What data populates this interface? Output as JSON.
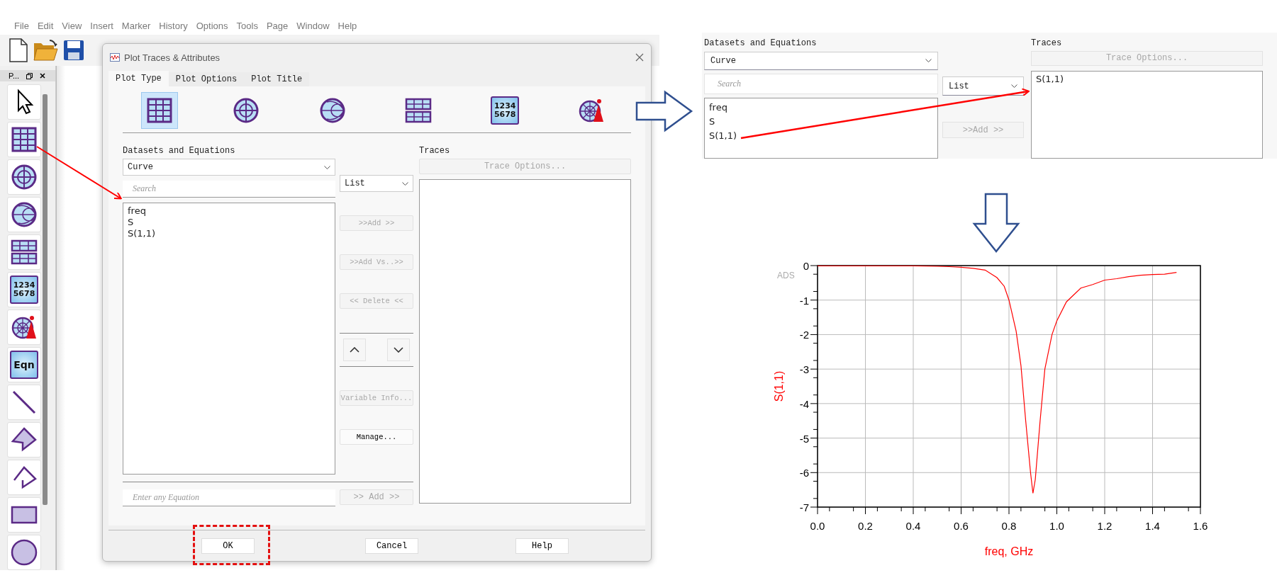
{
  "app": {
    "menu": [
      "File",
      "Edit",
      "View",
      "Insert",
      "Marker",
      "History",
      "Options",
      "Tools",
      "Page",
      "Window",
      "Help"
    ],
    "palette": {
      "title": "P...",
      "tools": [
        {
          "kind": "pointer"
        },
        {
          "kind": "grid"
        },
        {
          "kind": "polar"
        },
        {
          "kind": "smith"
        },
        {
          "kind": "list"
        },
        {
          "kind": "numbers",
          "lines": [
            "1234",
            "5678"
          ]
        },
        {
          "kind": "antenna"
        },
        {
          "kind": "equation",
          "label": "Eqn"
        },
        {
          "kind": "line"
        },
        {
          "kind": "polygon"
        },
        {
          "kind": "polyline"
        },
        {
          "kind": "rectangle"
        },
        {
          "kind": "circle"
        }
      ]
    }
  },
  "dialog": {
    "title": "Plot Traces & Attributes",
    "tabs": [
      {
        "label": "Plot Type",
        "selected": true
      },
      {
        "label": "Plot Options",
        "selected": false
      },
      {
        "label": "Plot Title",
        "selected": false
      }
    ],
    "plot_types": [
      {
        "kind": "grid",
        "selected": true
      },
      {
        "kind": "polar",
        "selected": false
      },
      {
        "kind": "smith",
        "selected": false
      },
      {
        "kind": "list",
        "selected": false
      },
      {
        "kind": "numbers",
        "lines": [
          "1234",
          "5678"
        ],
        "selected": false
      },
      {
        "kind": "antenna",
        "selected": false
      }
    ],
    "datasets_label": "Datasets and Equations",
    "source_dropdown": "Curve",
    "search": {
      "placeholder": "Search"
    },
    "variables": [
      "freq",
      "S",
      "S(1,1)"
    ],
    "view_dropdown": "List",
    "actions": [
      {
        "kind": "button",
        "label": ">>Add >>",
        "disabled": true
      },
      {
        "kind": "button",
        "label": ">>Add Vs..>>",
        "disabled": true
      },
      {
        "kind": "button",
        "label": "<< Delete <<",
        "disabled": true
      },
      {
        "kind": "reorder"
      },
      {
        "kind": "button",
        "label": "Variable Info...",
        "disabled": true
      },
      {
        "kind": "button",
        "label": "Manage...",
        "disabled": false
      }
    ],
    "equation": {
      "placeholder": "Enter any Equation"
    },
    "equation_button": {
      "label": ">> Add >>",
      "disabled": true
    },
    "traces_label": "Traces",
    "trace_options": {
      "label": "Trace Options...",
      "disabled": true
    },
    "footer_buttons": [
      {
        "label": "OK"
      },
      {
        "label": "Cancel"
      },
      {
        "label": "Help"
      }
    ]
  },
  "zoom_panel": {
    "datasets_label": "Datasets and Equations",
    "source_dropdown": "Curve",
    "search": {
      "placeholder": "Search"
    },
    "view_dropdown": "List",
    "variables": [
      "freq",
      "S",
      "S(1,1)"
    ],
    "add_button": {
      "label": ">>Add >>",
      "disabled": true
    },
    "traces_label": "Traces",
    "trace_options": {
      "label": "Trace Options...",
      "disabled": true
    },
    "traces": [
      "S(1,1)"
    ]
  },
  "plot": {
    "badge": "ADS",
    "chart_data": {
      "type": "line",
      "xlabel": "freq, GHz",
      "ylabel": "S(1,1)",
      "x": [
        0,
        0.1,
        0.2,
        0.3,
        0.4,
        0.5,
        0.55,
        0.6,
        0.65,
        0.7,
        0.75,
        0.78,
        0.8,
        0.83,
        0.85,
        0.87,
        0.89,
        0.9,
        0.91,
        0.93,
        0.95,
        0.98,
        1.0,
        1.04,
        1.1,
        1.15,
        1.2,
        1.25,
        1.3,
        1.35,
        1.4,
        1.45,
        1.5
      ],
      "series": [
        {
          "color": "#ff0000",
          "values": [
            -0.01,
            -0.01,
            -0.01,
            -0.01,
            -0.01,
            -0.02,
            -0.03,
            -0.05,
            -0.08,
            -0.13,
            -0.35,
            -0.6,
            -1.0,
            -1.9,
            -2.9,
            -4.5,
            -6.0,
            -6.6,
            -6.2,
            -4.5,
            -3.0,
            -2.0,
            -1.6,
            -1.05,
            -0.65,
            -0.55,
            -0.42,
            -0.38,
            -0.32,
            -0.28,
            -0.26,
            -0.25,
            -0.2
          ]
        }
      ],
      "xlim": [
        0,
        1.6
      ],
      "ylim": [
        -7,
        0
      ],
      "grid": true,
      "xticks": [
        {
          "value": 0,
          "label": "0.0"
        },
        {
          "value": 0.2,
          "label": "0.2"
        },
        {
          "value": 0.4,
          "label": "0.4"
        },
        {
          "value": 0.6,
          "label": "0.6"
        },
        {
          "value": 0.8,
          "label": "0.8"
        },
        {
          "value": 1.0,
          "label": "1.0"
        },
        {
          "value": 1.2,
          "label": "1.2"
        },
        {
          "value": 1.4,
          "label": "1.4"
        },
        {
          "value": 1.6,
          "label": "1.6"
        }
      ],
      "yticks": [
        0,
        -1,
        -2,
        -3,
        -4,
        -5,
        -6,
        -7
      ]
    }
  }
}
